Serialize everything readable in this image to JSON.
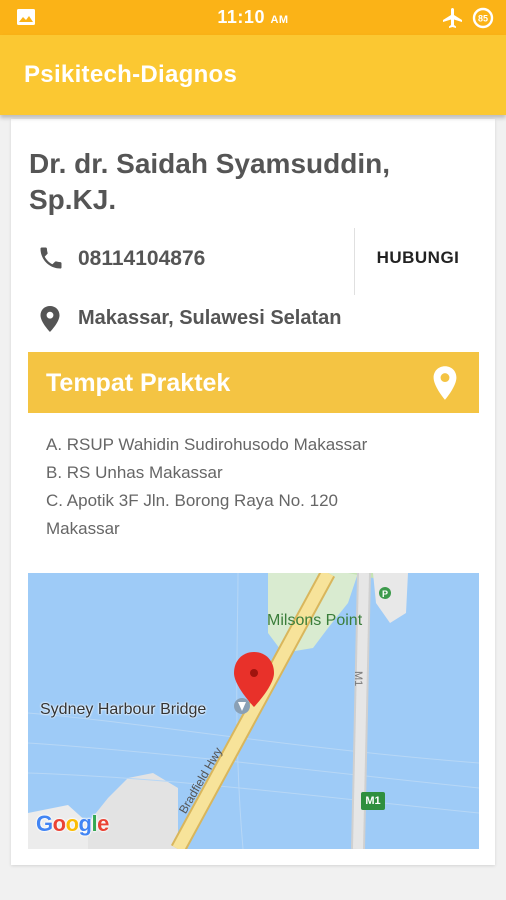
{
  "status_bar": {
    "time": "11:10",
    "time_suffix": "AM",
    "battery": "85",
    "icons": [
      "image-icon",
      "airplane-mode-icon",
      "battery-saver-icon"
    ]
  },
  "app_bar": {
    "title": "Psikitech-Diagnos"
  },
  "doctor": {
    "name": "Dr. dr. Saidah Syamsuddin, Sp.KJ.",
    "phone": "08114104876",
    "call_label": "HUBUNGI",
    "location": "Makassar, Sulawesi Selatan"
  },
  "praktek": {
    "header": "Tempat Praktek",
    "items": [
      "A. RSUP Wahidin Sudirohusodo Makassar",
      "B. RS Unhas Makassar",
      "C. Apotik 3F Jln. Borong Raya No. 120\nMakassar"
    ]
  },
  "map": {
    "labels": {
      "milsons": "Milsons Point",
      "bridge": "Sydney Harbour Bridge",
      "road": "Bradfield Hwy",
      "motorway_shield": "M1",
      "motorway_road": "M1",
      "brand": "Google"
    }
  },
  "colors": {
    "status_bar": "#fbb317",
    "app_bar": "#fbc832",
    "section_header": "#f4c443",
    "text_primary": "#555555",
    "map_water": "#9ecbf7"
  }
}
